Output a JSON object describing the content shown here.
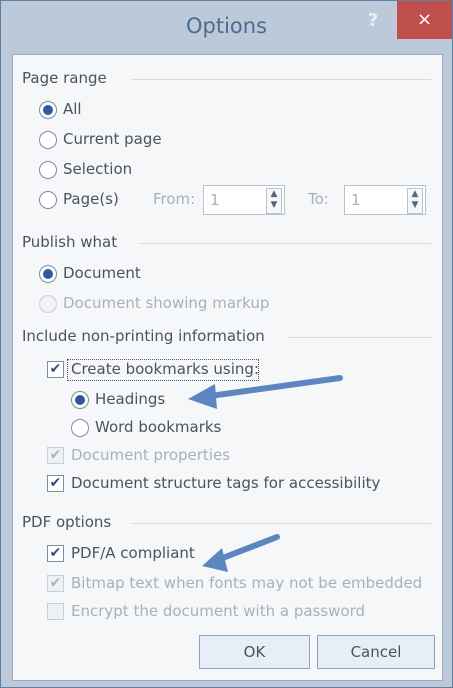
{
  "window": {
    "title": "Options",
    "help_label": "?",
    "close_label": "×"
  },
  "page_range": {
    "heading": "Page range",
    "options": [
      "All",
      "Current page",
      "Selection",
      "Page(s)"
    ],
    "from_label": "From:",
    "from_value": "1",
    "to_label": "To:",
    "to_value": "1"
  },
  "publish_what": {
    "heading": "Publish what",
    "options": [
      "Document",
      "Document showing markup"
    ]
  },
  "non_printing": {
    "heading": "Include non-printing information",
    "create_bookmarks_label": "Create bookmarks using:",
    "bookmark_options": [
      "Headings",
      "Word bookmarks"
    ],
    "document_properties_label": "Document properties",
    "structure_tags_label": "Document structure tags for accessibility"
  },
  "pdf_options": {
    "heading": "PDF options",
    "pdfa_label": "PDF/A compliant",
    "bitmap_label": "Bitmap text when fonts may not be embedded",
    "encrypt_label": "Encrypt the document with a password"
  },
  "buttons": {
    "ok": "OK",
    "cancel": "Cancel"
  },
  "icons": {
    "check": "✔",
    "spin_up": "▲",
    "spin_down": "▼"
  },
  "colors": {
    "accent": "#2f5b9a",
    "arrow": "#5d86c0",
    "close": "#c0504d"
  }
}
